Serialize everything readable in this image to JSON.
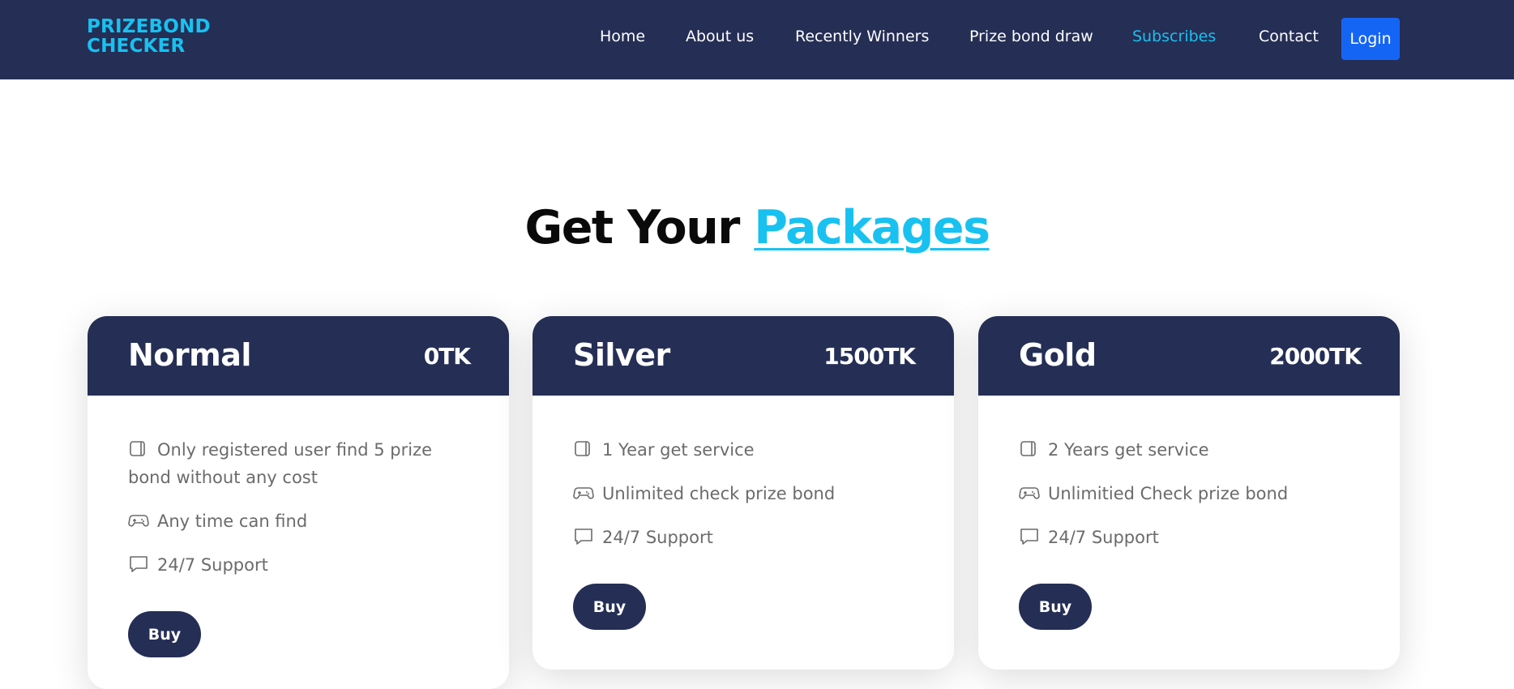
{
  "brand": {
    "line1": "PRIZEBOND",
    "line2": "CHECKER"
  },
  "nav": {
    "home": "Home",
    "about": "About us",
    "winners": "Recently Winners",
    "draw": "Prize bond draw",
    "subscribes": "Subscribes",
    "contact": "Contact",
    "login": "Login"
  },
  "heading": {
    "prefix": "Get Your ",
    "accent": "Packages"
  },
  "packages": [
    {
      "name": "Normal",
      "price": "0TK",
      "features": [
        {
          "icon": "tablet-icon",
          "text": "Only registered user find 5 prize bond without any cost"
        },
        {
          "icon": "gamepad-icon",
          "text": "Any time can find"
        },
        {
          "icon": "chat-icon",
          "text": "24/7 Support"
        }
      ],
      "buy": "Buy"
    },
    {
      "name": "Silver",
      "price": "1500TK",
      "features": [
        {
          "icon": "tablet-icon",
          "text": "1 Year get service"
        },
        {
          "icon": "gamepad-icon",
          "text": "Unlimited check prize bond"
        },
        {
          "icon": "chat-icon",
          "text": "24/7 Support"
        }
      ],
      "buy": "Buy"
    },
    {
      "name": "Gold",
      "price": "2000TK",
      "features": [
        {
          "icon": "tablet-icon",
          "text": "2 Years get service"
        },
        {
          "icon": "gamepad-icon",
          "text": "Unlimitied Check prize bond"
        },
        {
          "icon": "chat-icon",
          "text": "24/7 Support"
        }
      ],
      "buy": "Buy"
    }
  ],
  "colors": {
    "navy": "#252e55",
    "accent": "#18c1f0",
    "login_blue": "#1565f5"
  }
}
